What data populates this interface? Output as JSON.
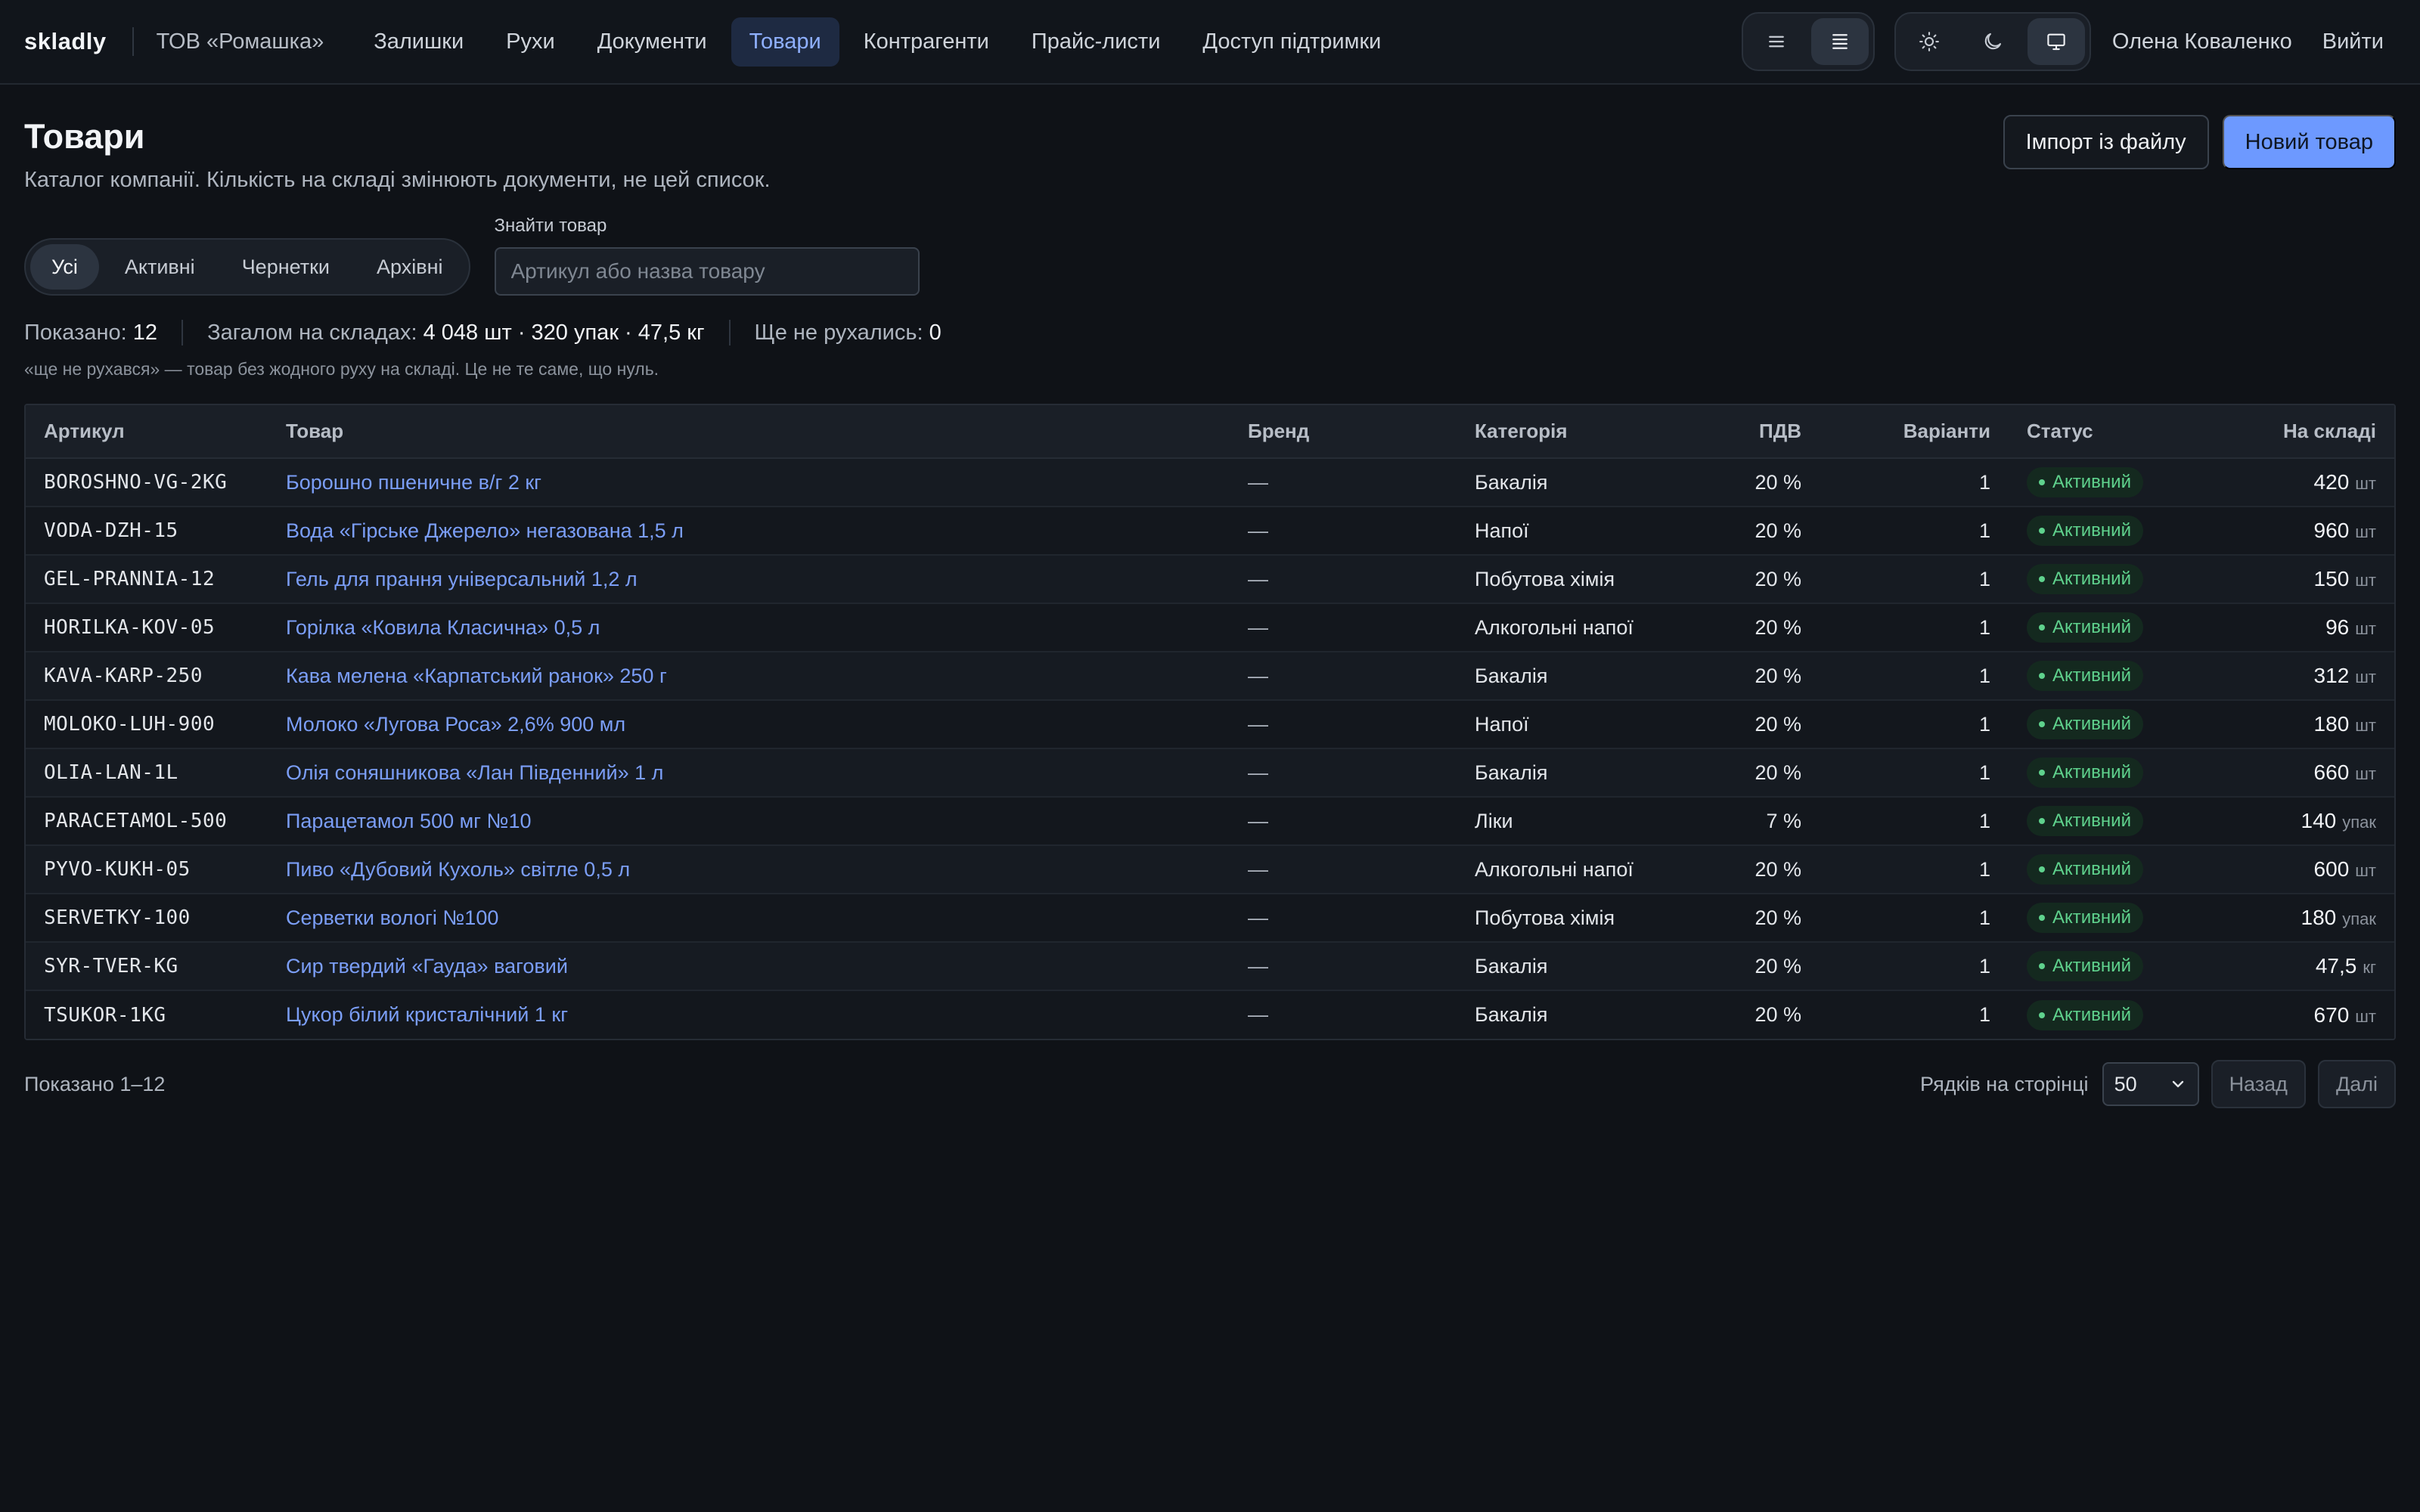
{
  "topbar": {
    "logo": "skladly",
    "company": "ТОВ «Ромашка»",
    "nav": [
      {
        "label": "Залишки",
        "active": false
      },
      {
        "label": "Рухи",
        "active": false
      },
      {
        "label": "Документи",
        "active": false
      },
      {
        "label": "Товари",
        "active": true
      },
      {
        "label": "Контрагенти",
        "active": false
      },
      {
        "label": "Прайс-листи",
        "active": false
      },
      {
        "label": "Доступ підтримки",
        "active": false
      }
    ],
    "density_icons": [
      "list-icon",
      "list-dense-icon"
    ],
    "density_selected": "list-dense-icon",
    "theme_icons": [
      "sun-icon",
      "moon-icon",
      "monitor-icon"
    ],
    "theme_selected": "monitor-icon",
    "user": "Олена Коваленко",
    "logout": "Вийти"
  },
  "page": {
    "title": "Товари",
    "subtitle": "Каталог компанії. Кількість на складі змінюють документи, не цей список.",
    "import_button": "Імпорт із файлу",
    "new_button": "Новий товар"
  },
  "filters": {
    "tabs": [
      {
        "label": "Усі",
        "active": true
      },
      {
        "label": "Активні",
        "active": false
      },
      {
        "label": "Чернетки",
        "active": false
      },
      {
        "label": "Архівні",
        "active": false
      }
    ],
    "search_label": "Знайти товар",
    "search_placeholder": "Артикул або назва товару",
    "search_value": ""
  },
  "stats": {
    "shown_label": "Показано:",
    "shown_value": "12",
    "total_label": "Загалом на складах:",
    "total_value": "4 048 шт · 320 упак · 47,5 кг",
    "unmoved_label": "Ще не рухались:",
    "unmoved_value": "0",
    "note": "«ще не рухався» — товар без жодного руху на складі. Це не те саме, що нуль."
  },
  "table": {
    "columns": [
      "Артикул",
      "Товар",
      "Бренд",
      "Категорія",
      "ПДВ",
      "Варіанти",
      "Статус",
      "На складі"
    ],
    "rows": [
      {
        "sku": "BOROSHNO-VG-2KG",
        "name": "Борошно пшеничне в/г 2 кг",
        "brand": "—",
        "category": "Бакалія",
        "vat": "20 %",
        "variants": "1",
        "status": "Активний",
        "qty": "420",
        "unit": "шт"
      },
      {
        "sku": "VODA-DZH-15",
        "name": "Вода «Гірське Джерело» негазована 1,5 л",
        "brand": "—",
        "category": "Напої",
        "vat": "20 %",
        "variants": "1",
        "status": "Активний",
        "qty": "960",
        "unit": "шт"
      },
      {
        "sku": "GEL-PRANNIA-12",
        "name": "Гель для прання універсальний 1,2 л",
        "brand": "—",
        "category": "Побутова хімія",
        "vat": "20 %",
        "variants": "1",
        "status": "Активний",
        "qty": "150",
        "unit": "шт"
      },
      {
        "sku": "HORILKA-KOV-05",
        "name": "Горілка «Ковила Класична» 0,5 л",
        "brand": "—",
        "category": "Алкогольні напої",
        "vat": "20 %",
        "variants": "1",
        "status": "Активний",
        "qty": "96",
        "unit": "шт"
      },
      {
        "sku": "KAVA-KARP-250",
        "name": "Кава мелена «Карпатський ранок» 250 г",
        "brand": "—",
        "category": "Бакалія",
        "vat": "20 %",
        "variants": "1",
        "status": "Активний",
        "qty": "312",
        "unit": "шт"
      },
      {
        "sku": "MOLOKO-LUH-900",
        "name": "Молоко «Лугова Роса» 2,6% 900 мл",
        "brand": "—",
        "category": "Напої",
        "vat": "20 %",
        "variants": "1",
        "status": "Активний",
        "qty": "180",
        "unit": "шт"
      },
      {
        "sku": "OLIA-LAN-1L",
        "name": "Олія соняшникова «Лан Південний» 1 л",
        "brand": "—",
        "category": "Бакалія",
        "vat": "20 %",
        "variants": "1",
        "status": "Активний",
        "qty": "660",
        "unit": "шт"
      },
      {
        "sku": "PARACETAMOL-500",
        "name": "Парацетамол 500 мг №10",
        "brand": "—",
        "category": "Ліки",
        "vat": "7 %",
        "variants": "1",
        "status": "Активний",
        "qty": "140",
        "unit": "упак"
      },
      {
        "sku": "PYVO-KUKH-05",
        "name": "Пиво «Дубовий Кухоль» світле 0,5 л",
        "brand": "—",
        "category": "Алкогольні напої",
        "vat": "20 %",
        "variants": "1",
        "status": "Активний",
        "qty": "600",
        "unit": "шт"
      },
      {
        "sku": "SERVETKY-100",
        "name": "Серветки вологі №100",
        "brand": "—",
        "category": "Побутова хімія",
        "vat": "20 %",
        "variants": "1",
        "status": "Активний",
        "qty": "180",
        "unit": "упак"
      },
      {
        "sku": "SYR-TVER-KG",
        "name": "Сир твердий «Гауда» ваговий",
        "brand": "—",
        "category": "Бакалія",
        "vat": "20 %",
        "variants": "1",
        "status": "Активний",
        "qty": "47,5",
        "unit": "кг"
      },
      {
        "sku": "TSUKOR-1KG",
        "name": "Цукор білий кристалічний 1 кг",
        "brand": "—",
        "category": "Бакалія",
        "vat": "20 %",
        "variants": "1",
        "status": "Активний",
        "qty": "670",
        "unit": "шт"
      }
    ]
  },
  "footer": {
    "shown_range": "Показано 1–12",
    "rows_label": "Рядків на сторінці",
    "rows_value": "50",
    "prev": "Назад",
    "next": "Далі"
  },
  "colors": {
    "background": "#0f1217",
    "accent": "#6d99ff",
    "link": "#7b9ef7",
    "status_active": "#5fd28d"
  }
}
